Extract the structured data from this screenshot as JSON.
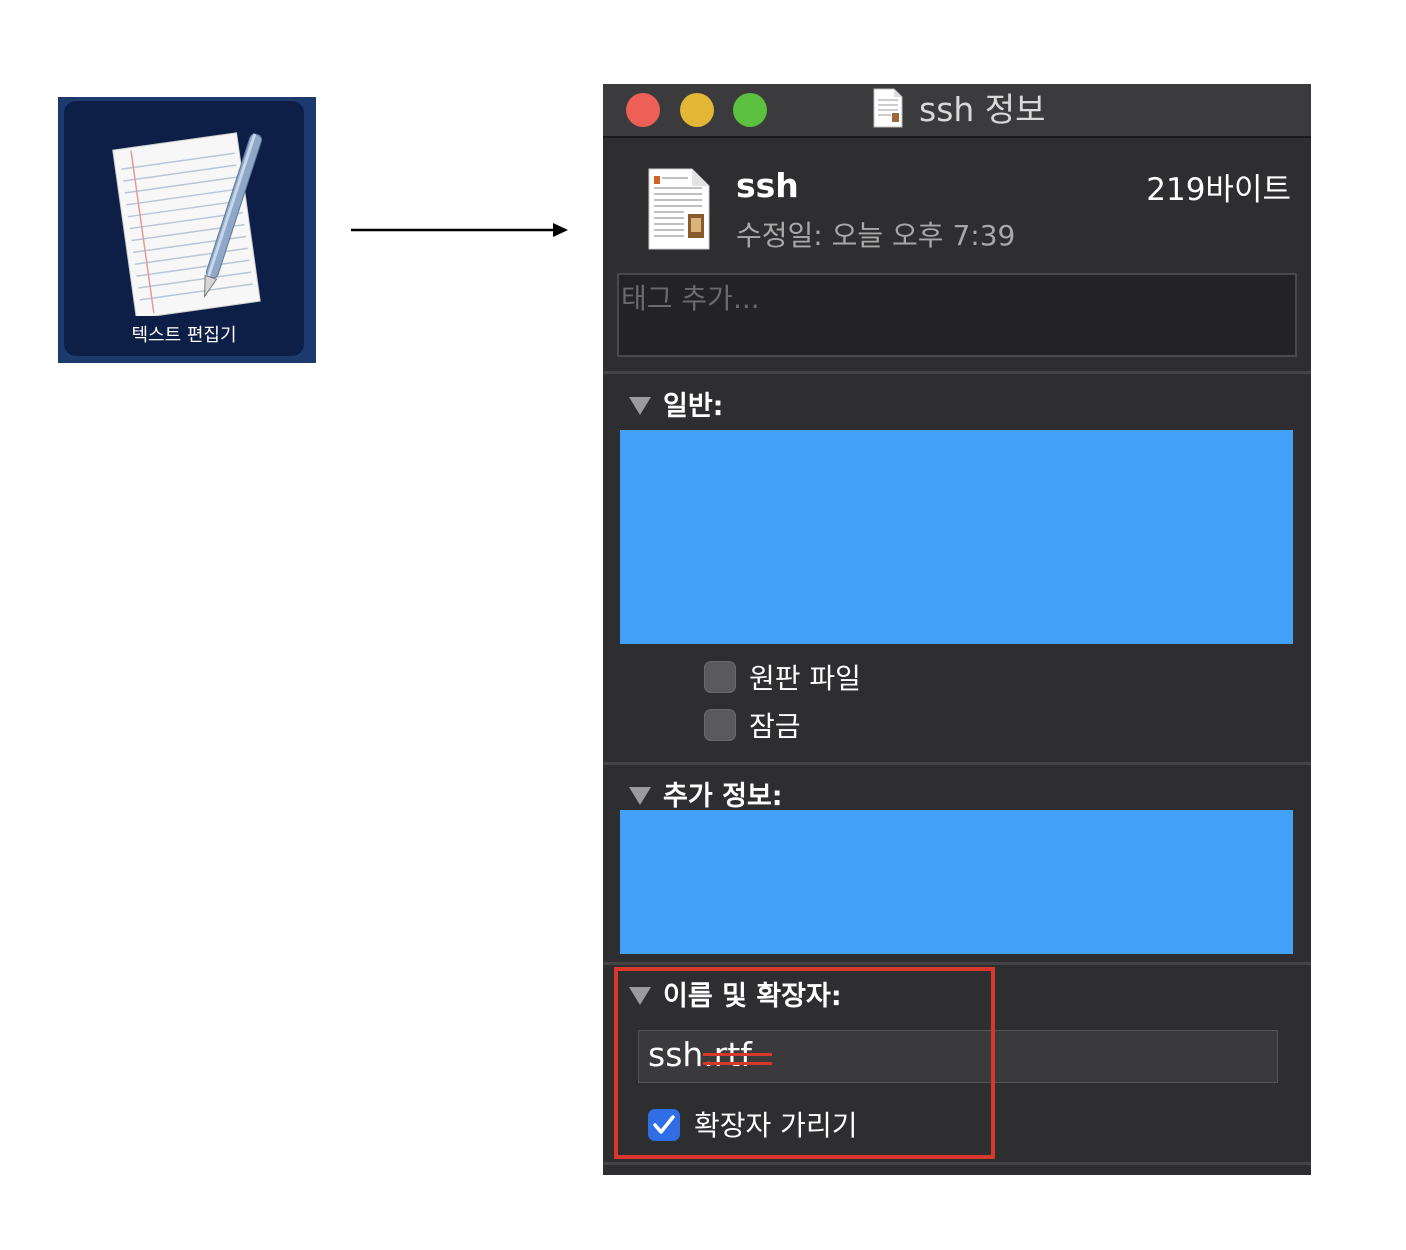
{
  "app_icon": {
    "label": "텍스트 편집기",
    "icon": "textedit-icon"
  },
  "window": {
    "title": "ssh 정보",
    "file": {
      "name": "ssh",
      "size": "219바이트",
      "modified": "수정일: 오늘 오후 7:39"
    },
    "tags": {
      "placeholder": "태그 추가..."
    },
    "sections": {
      "general": {
        "title": "일반:",
        "stationery_label": "원판 파일",
        "stationery_checked": false,
        "locked_label": "잠금",
        "locked_checked": false
      },
      "more_info": {
        "title": "추가 정보:"
      },
      "name_ext": {
        "title": "이름 및 확장자:",
        "name_base": "ssh",
        "name_ext": ".rtf",
        "hide_extension_label": "확장자 가리기",
        "hide_extension_checked": true
      }
    }
  },
  "colors": {
    "window_bg": "#2e2e30",
    "redaction": "#42a1f7",
    "highlight": "#d8382b",
    "checkbox_on": "#2f6ee4"
  }
}
